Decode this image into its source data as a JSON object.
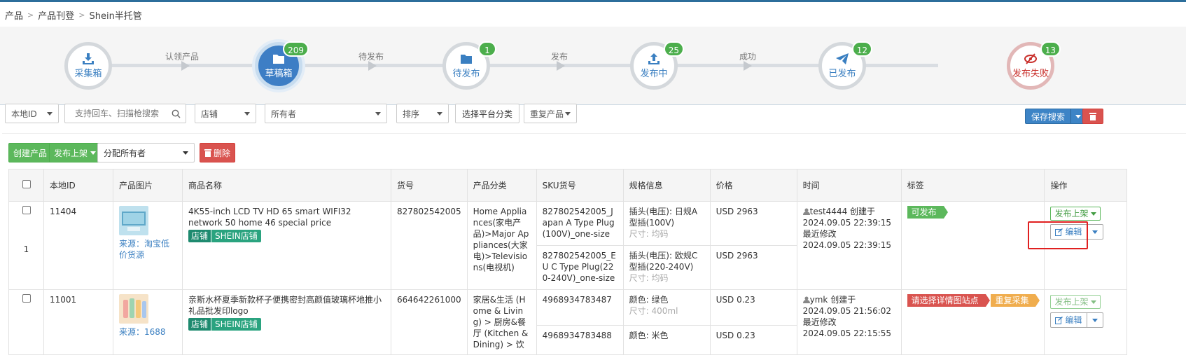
{
  "breadcrumb": [
    "产品",
    "产品刊登",
    "Shein半托管"
  ],
  "stepper": {
    "steps": [
      {
        "label": "采集箱",
        "icon": "download-icon",
        "badge": null,
        "state": "normal"
      },
      {
        "label": "草稿箱",
        "icon": "folder-icon",
        "badge": "209",
        "state": "active"
      },
      {
        "label": "待发布",
        "icon": "folder-icon",
        "badge": "1",
        "state": "normal"
      },
      {
        "label": "发布中",
        "icon": "upload-icon",
        "badge": "25",
        "state": "normal"
      },
      {
        "label": "已发布",
        "icon": "paper-plane-icon",
        "badge": "12",
        "state": "normal"
      },
      {
        "label": "发布失败",
        "icon": "eye-slash-icon",
        "badge": "13",
        "state": "failed"
      }
    ],
    "connectors": [
      "认领产品",
      "待发布",
      "发布",
      "成功"
    ]
  },
  "filters": {
    "local_id": "本地ID",
    "search_placeholder": "支持回车、扫描枪搜索",
    "shop": "店铺",
    "owner": "所有者",
    "sort": "排序",
    "platform_category": "选择平台分类",
    "duplicate": "重复产品",
    "save_search": "保存搜索"
  },
  "toolbar": {
    "create": "创建产品",
    "publish": "发布上架",
    "assign": "分配所有者",
    "delete": "删除"
  },
  "table": {
    "headers": [
      "本地ID",
      "产品图片",
      "商品名称",
      "货号",
      "产品分类",
      "SKU货号",
      "规格信息",
      "价格",
      "时间",
      "标签",
      "操作"
    ],
    "rows": [
      {
        "index": "1",
        "id": "11404",
        "source": "来源：淘宝低价货源",
        "name": "4K55-inch LCD TV HD 65 smart WIFI32 network 50 home 46 special price",
        "shop_tag": "店铺",
        "shop_name": "SHEIN店铺",
        "item_no": "827802542005",
        "category": "Home Appliances(家电产品)>Major Appliances(大家电)>Televisions(电视机)",
        "skus": [
          {
            "sku": "827802542005_Japan A Type Plug(100V)_one-size",
            "spec": "插头(电压): 日规A型插(100V)",
            "size": "尺寸: 均码",
            "price": "USD 2963"
          },
          {
            "sku": "827802542005_EU C Type Plug(220-240V)_one-size",
            "spec": "插头(电压): 欧规C型插(220-240V)",
            "size": "尺寸: 均码",
            "price": "USD 2963"
          }
        ],
        "user": "test4444",
        "created_label": "创建于",
        "created": "2024.09.05 22:39:15",
        "modified_label": "最近修改",
        "modified": "2024.09.05 22:39:15",
        "tags": [
          {
            "text": "可发布",
            "color": "green"
          }
        ],
        "op_publish": "发布上架",
        "op_edit": "编辑"
      },
      {
        "id": "11001",
        "source": "来源：1688",
        "name": "亲斯水杯夏季新款杯子便携密封高颜值玻璃杯地推小礼品批发印logo",
        "shop_tag": "店铺",
        "shop_name": "SHEIN店铺",
        "item_no": "664642261000",
        "category": "家居&生活 (Home & Living) > 厨房&餐厅 (Kitchen & Dining) > 饮",
        "skus": [
          {
            "sku": "4968934783487",
            "spec": "颜色: 绿色",
            "size": "尺寸: 400ml",
            "price": "USD 0.23"
          },
          {
            "sku": "4968934783488",
            "spec": "颜色: 米色",
            "size": "",
            "price": "USD 0.23"
          }
        ],
        "user": "ymk",
        "created_label": "创建于",
        "created": "2024.09.05 21:56:02",
        "modified_label": "最近修改",
        "modified": "2024.09.05 22:15:55",
        "tags": [
          {
            "text": "请选择详情图站点",
            "color": "red"
          },
          {
            "text": "重复采集",
            "color": "orange"
          }
        ],
        "op_publish": "发布上架",
        "op_edit": "编辑"
      }
    ]
  }
}
